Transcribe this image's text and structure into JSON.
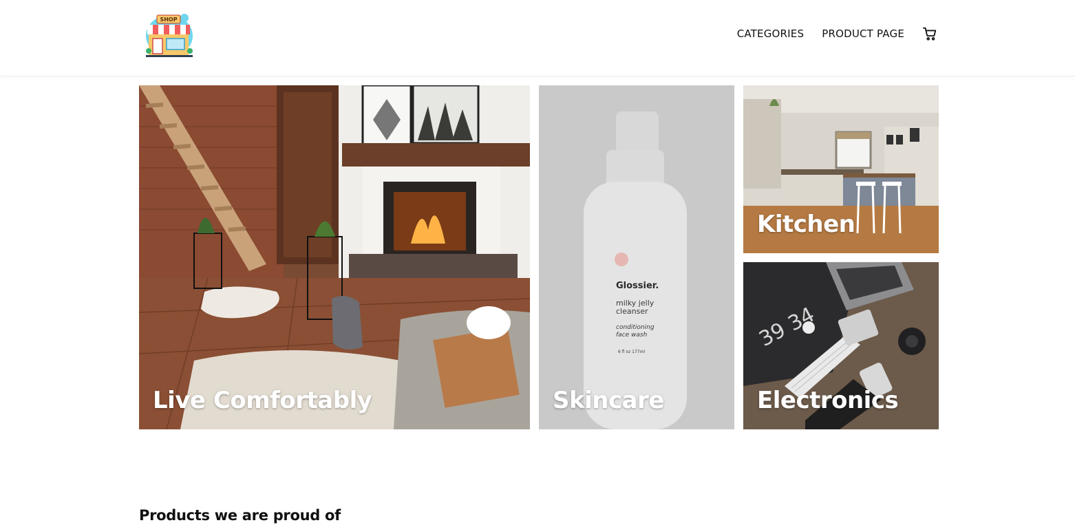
{
  "header": {
    "logo_icon": "shop-storefront-icon",
    "logo_text": "SHOP",
    "nav": [
      {
        "label": "CATEGORIES"
      },
      {
        "label": "PRODUCT PAGE"
      }
    ],
    "cart_icon": "shopping-cart-icon"
  },
  "tiles": [
    {
      "label": "Live Comfortably"
    },
    {
      "label": "Skincare",
      "product": {
        "brand": "Glossier.",
        "name_line1": "milky jelly",
        "name_line2": "cleanser",
        "desc_line1": "conditioning",
        "desc_line2": "face wash",
        "size": "6 fl oz  177ml"
      }
    },
    {
      "label": "Kitchen"
    },
    {
      "label": "Electronics",
      "screen_text": "39 34"
    }
  ],
  "section": {
    "title": "Products we are proud of"
  }
}
